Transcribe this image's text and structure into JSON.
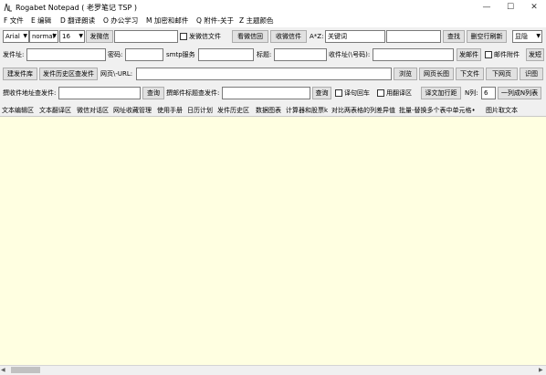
{
  "window": {
    "title": "Rogabet Notepad ( 老罗笔记 TSP )",
    "minimize": "—",
    "maximize": "☐",
    "close": "✕"
  },
  "menu": [
    "F 文件",
    "E 编辑",
    "D 翻译朗读",
    "O 办公学习",
    "M 加密和邮件",
    "Q 附件-关于",
    "Z 主题颜色"
  ],
  "row1": {
    "font_family": "Arial",
    "font_style": "normal",
    "font_size": "16",
    "send_wechat": "发微信",
    "wechat_input": "",
    "send_wechat_file_label": "发微信文件",
    "view_wechat_return": "看微信回",
    "receive_wechat": "收微信件",
    "az_label": "A*Z:",
    "keyword_value": "关键词",
    "keyword_extra": "",
    "find": "查找",
    "clear_refresh": "删空行刷新",
    "show_hide": "显隐"
  },
  "row2": {
    "sender_label": "发件址:",
    "sender_value": "",
    "password_label": "密码:",
    "password_value": "",
    "smtp_label": "smtp服务",
    "smtp_value": "",
    "subject_label": "标题:",
    "subject_value": "",
    "receiver_label": "收件址(\\号码):",
    "receiver_value": "",
    "send_mail": "发邮件",
    "mail_attach_label": "邮件附件",
    "more": "发短"
  },
  "row3": {
    "build_library": "建发件库",
    "history_query": "发件历史区查发件",
    "url_label": "网页\\-URL:",
    "url_value": "",
    "browse": "浏览",
    "long_screenshot": "网页长图",
    "download_file": "下文件",
    "download_page": "下网页",
    "recognize": "识图"
  },
  "row4": {
    "inbox_addr_label": "撰收件地址查发件:",
    "inbox_addr_value": "",
    "query1": "查询",
    "mail_subject_label": "撰邮件标题查发件:",
    "mail_subject_value": "",
    "query2": "查询",
    "line_wrap_label": "译句回车",
    "use_translate_label": "用翻译区",
    "translate_spacing": "译文加行距",
    "n_col_label": "N列:",
    "n_col_value": "6",
    "split_columns": "一列成N列表"
  },
  "tabs": [
    "文本编辑区",
    "文本翻译区",
    "微信对话区",
    "网址收藏管理",
    "使用手册",
    "日历计划",
    "发件历史区",
    "数据图表",
    "计算器和股票k",
    "对比两表格的列差异值",
    "批量-替换多个表中单元格•",
    "图片取文本"
  ],
  "editor_text": "",
  "scroll": {
    "left": "◀",
    "right": "▶"
  },
  "colors": {
    "editor_bg": "#ffffe1",
    "chrome_bg": "#f0f0f0"
  }
}
